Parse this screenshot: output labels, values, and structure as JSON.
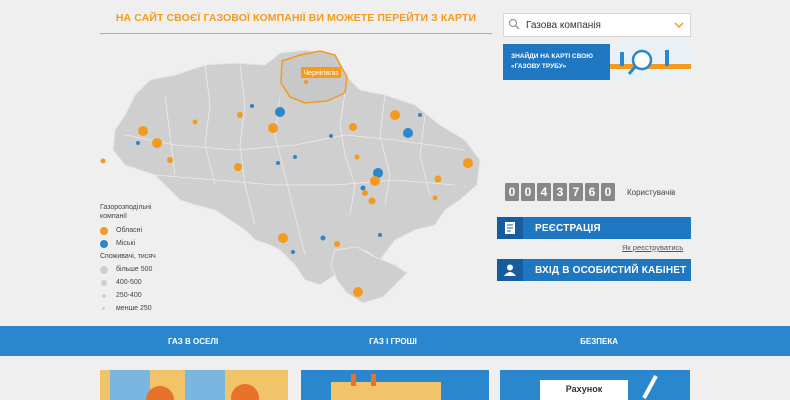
{
  "map": {
    "title": "НА САЙТ СВОЄЇ ГАЗОВОЇ КОМПАНІЇ ВИ МОЖЕТЕ ПЕРЕЙТИ З КАРТИ",
    "highlight_region": "Чернігівгаз"
  },
  "legend": {
    "heading_line1": "Газорозподільні",
    "heading_line2": "компанії",
    "regional": "Обласні",
    "city": "Міські",
    "consumers_heading": "Споживачі, тисяч",
    "sizes": [
      "більше 500",
      "400-500",
      "250-400",
      "менше 250"
    ]
  },
  "search": {
    "value": "Газова компанія"
  },
  "banner": {
    "line1": "ЗНАЙДИ НА КАРТІ СВОЮ",
    "line2": "«ГАЗОВУ ТРУБУ»"
  },
  "counter": {
    "digits": [
      "0",
      "0",
      "4",
      "3",
      "7",
      "6",
      "0"
    ],
    "label": "Користувачів"
  },
  "buttons": {
    "register": "РЕЄСТРАЦІЯ",
    "how_register": "Як реєструватись",
    "login": "ВХІД В ОСОБИСТИЙ КАБІНЕТ"
  },
  "nav": {
    "items": [
      "ГАЗ В ОСЕЛІ",
      "ГАЗ І ГРОШІ",
      "БЕЗПЕКА"
    ]
  },
  "cards": {
    "bill": "Рахунок"
  },
  "colors": {
    "accent_orange": "#f39a1f",
    "blue": "#2a86cd",
    "map_gray": "#cfcfcf"
  },
  "icons": {
    "search": "search-icon",
    "dropdown": "chevron-down-icon",
    "register": "document-icon",
    "login": "user-icon",
    "banner": "magnifier-pipe-icon"
  }
}
